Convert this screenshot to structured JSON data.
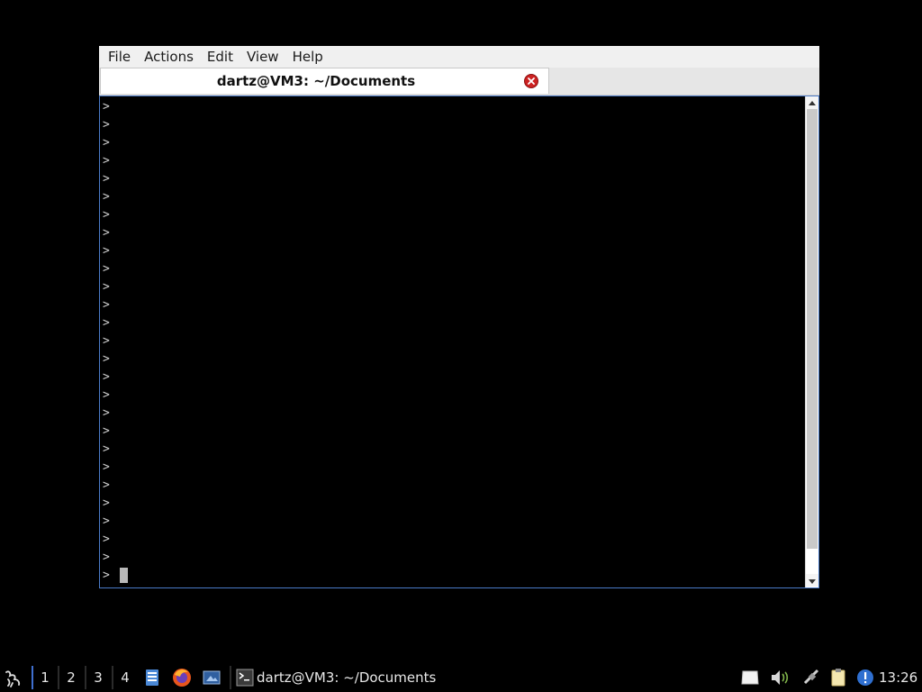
{
  "window": {
    "menu": [
      "File",
      "Actions",
      "Edit",
      "View",
      "Help"
    ],
    "tab_title": "dartz@VM3: ~/Documents"
  },
  "terminal": {
    "lines": [
      ">",
      ">",
      ">",
      ">",
      ">",
      ">",
      ">",
      ">",
      ">",
      ">",
      ">",
      ">",
      ">",
      ">",
      ">",
      ">",
      ">",
      ">",
      ">",
      ">",
      ">",
      ">",
      ">",
      ">",
      ">",
      ">",
      ">"
    ]
  },
  "taskbar": {
    "desktops": [
      "1",
      "2",
      "3",
      "4"
    ],
    "task_label": "dartz@VM3: ~/Documents",
    "clock": "13:26"
  },
  "colors": {
    "accent": "#3f6fcf",
    "terminal_bg": "#000000",
    "close_button": "#cc2222"
  }
}
